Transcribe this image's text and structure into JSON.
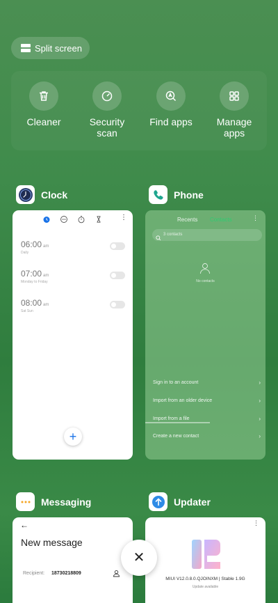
{
  "split_screen": {
    "label": "Split screen"
  },
  "quick_actions": [
    {
      "label": "Cleaner",
      "icon": "trash-icon"
    },
    {
      "label": "Security\nscan",
      "icon": "security-icon"
    },
    {
      "label": "Find apps",
      "icon": "find-apps-icon"
    },
    {
      "label": "Manage\napps",
      "icon": "grid-icon"
    }
  ],
  "apps": {
    "clock": {
      "name": "Clock",
      "alarms": [
        {
          "time": "06:00",
          "ampm": "am",
          "repeat": "Daily"
        },
        {
          "time": "07:00",
          "ampm": "am",
          "repeat": "Monday to Friday"
        },
        {
          "time": "08:00",
          "ampm": "am",
          "repeat": "Sat Sun"
        }
      ],
      "fab": "+"
    },
    "phone": {
      "name": "Phone",
      "tabs": {
        "recents": "Recents",
        "contacts": "Contacts"
      },
      "search_placeholder": "3 contacts",
      "empty_text": "No contacts",
      "rows": [
        {
          "label": "Sign in to an account"
        },
        {
          "label": "Import from an older device"
        },
        {
          "label": "Import from a file"
        },
        {
          "label": "Create a new contact"
        }
      ],
      "chevron": "›"
    },
    "messaging": {
      "name": "Messaging",
      "title": "New message",
      "recipient_label": "Recipient:",
      "recipient_value": "18730218809",
      "back": "←"
    },
    "updater": {
      "name": "Updater",
      "version": "MIUI V12.0.8.0.QJOINXM | Stable 1.9G",
      "status": "Update available"
    }
  },
  "close": {
    "symbol": "✕"
  },
  "colors": {
    "accent_green": "#2ecc71",
    "clock_blue": "#1a73e8",
    "phone_teal": "#1fa58f"
  }
}
